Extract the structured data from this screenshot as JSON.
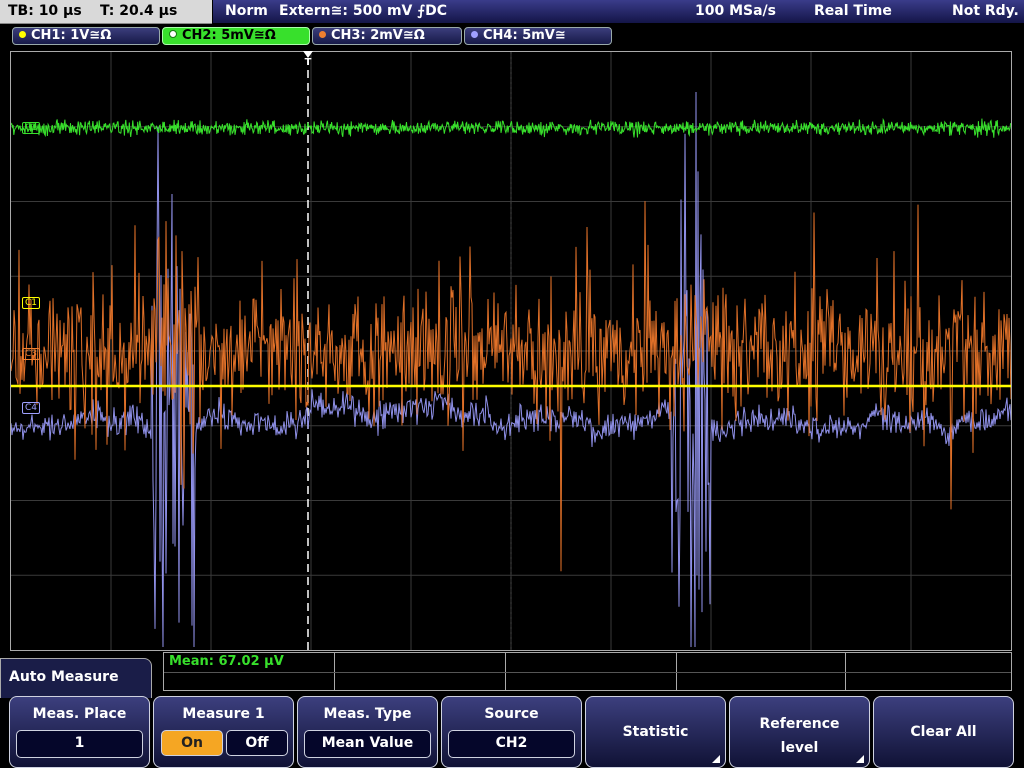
{
  "status_bar": {
    "timebase": "TB: 10 µs",
    "trigger_time": "T: 20.4 µs",
    "trigger_mode": "Norm",
    "trigger_source": "Extern≅: 500 mV ⨍DC",
    "sample_rate": "100 MSa/s",
    "acquisition_mode": "Real Time",
    "state": "Not Rdy."
  },
  "channels": [
    {
      "label": "CH1: 1V≅Ω",
      "color": "#ffff00",
      "marker": "C1"
    },
    {
      "label": "CH2: 5mV≅Ω",
      "color": "#38e02c",
      "marker": "C2",
      "active": true
    },
    {
      "label": "CH3: 2mV≅Ω",
      "color": "#f08030",
      "marker": "C3"
    },
    {
      "label": "CH4: 5mV≅",
      "color": "#9fa0ff",
      "marker": "C4"
    }
  ],
  "trigger_marker": "T",
  "measurement": {
    "result": "Mean: 67.02 µV"
  },
  "menu_title": "Auto Measure",
  "softkeys": {
    "meas_place": {
      "title": "Meas. Place",
      "value": "1"
    },
    "measure1": {
      "title": "Measure 1",
      "on": "On",
      "off": "Off",
      "state": "On"
    },
    "meas_type": {
      "title": "Meas. Type",
      "value": "Mean Value"
    },
    "source": {
      "title": "Source",
      "value": "CH2"
    },
    "statistic": {
      "label": "Statistic"
    },
    "reference_level": {
      "line1": "Reference",
      "line2": "level"
    },
    "clear_all": {
      "label": "Clear All"
    }
  },
  "colors": {
    "ch1": "#ffff00",
    "ch2": "#38e02c",
    "ch3": "#e07028",
    "ch4": "#8f90e8"
  }
}
